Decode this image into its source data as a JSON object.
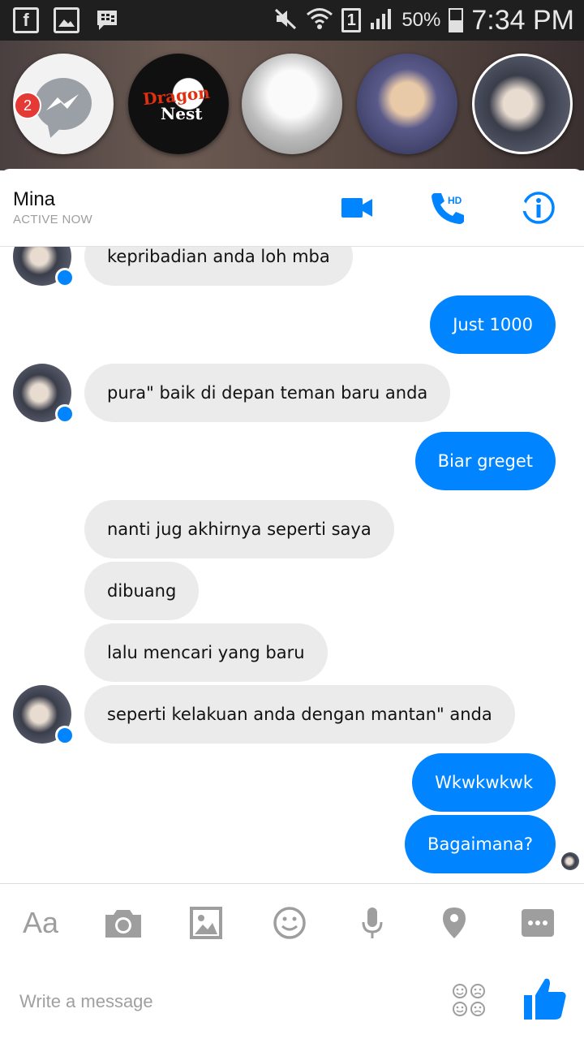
{
  "status_bar": {
    "battery": "50%",
    "time": "7:34 PM",
    "sim": "1"
  },
  "chat_heads": {
    "badge_count": "2",
    "dragon_nest_line1": "Dragon",
    "dragon_nest_line2": "Nest"
  },
  "header": {
    "name": "Mina",
    "status": "ACTIVE NOW",
    "call_hd": "HD"
  },
  "messages": [
    {
      "side": "in",
      "text": "kepribadian anda loh mba"
    },
    {
      "side": "out",
      "text": "Just 1000"
    },
    {
      "side": "in",
      "text": "pura\" baik di depan teman baru anda"
    },
    {
      "side": "out",
      "text": "Biar greget"
    },
    {
      "side": "in",
      "text": "nanti jug akhirnya seperti saya"
    },
    {
      "side": "in",
      "text": "dibuang"
    },
    {
      "side": "in",
      "text": "lalu mencari yang baru"
    },
    {
      "side": "in",
      "text": "seperti kelakuan anda dengan mantan\" anda"
    },
    {
      "side": "out",
      "text": "Wkwkwkwk"
    },
    {
      "side": "out",
      "text": "Bagaimana?"
    }
  ],
  "toolbar": {
    "text_format": "Aa",
    "icons": [
      "camera-icon",
      "gallery-icon",
      "emoji-icon",
      "microphone-icon",
      "location-icon",
      "more-icon"
    ]
  },
  "composer": {
    "placeholder": "Write a message"
  },
  "colors": {
    "accent": "#0084ff",
    "incoming_bubble": "#ebebeb",
    "badge": "#e53935"
  }
}
